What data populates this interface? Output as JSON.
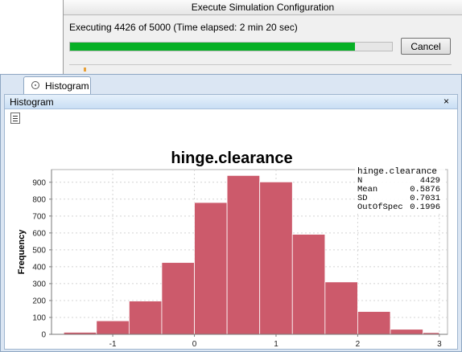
{
  "dialog": {
    "title": "Execute Simulation Configuration",
    "status": "Executing 4426 of 5000 (Time elapsed: 2 min 20 sec)",
    "progress": 0.8852,
    "cancel_label": "Cancel"
  },
  "tab": {
    "label": "Histogram",
    "icon": "histogram-tab-icon"
  },
  "panel": {
    "title": "Histogram",
    "close_glyph": "×",
    "export_icon": "export-icon"
  },
  "colors": {
    "progress": "#06b025",
    "bar": "#cc5a6b",
    "bar_edge": "#ffffff",
    "panel_header": "#c9def4"
  },
  "chart_data": {
    "type": "bar",
    "title": "hinge.clearance",
    "xlabel": "hinge.clearance",
    "ylabel": "Frequency",
    "xlim": [
      -1.75,
      3.1
    ],
    "ylim": [
      0,
      975
    ],
    "xticks": [
      -1,
      0,
      1,
      2,
      3
    ],
    "yticks": [
      0,
      100,
      200,
      300,
      400,
      500,
      600,
      700,
      800,
      900
    ],
    "grid": true,
    "bin_edges": [
      -1.6,
      -1.2,
      -0.8,
      -0.4,
      0.0,
      0.4,
      0.8,
      1.2,
      1.6,
      2.0,
      2.4,
      2.8,
      3.0
    ],
    "values": [
      12,
      80,
      197,
      425,
      780,
      940,
      902,
      592,
      310,
      135,
      30,
      10
    ],
    "stats": {
      "name": "hinge.clearance",
      "rows": [
        {
          "label": "N",
          "value": "4429"
        },
        {
          "label": "Mean",
          "value": "0.5876"
        },
        {
          "label": "SD",
          "value": "0.7031"
        },
        {
          "label": "OutOfSpec",
          "value": "0.1996"
        }
      ],
      "placement": "top-right"
    }
  }
}
